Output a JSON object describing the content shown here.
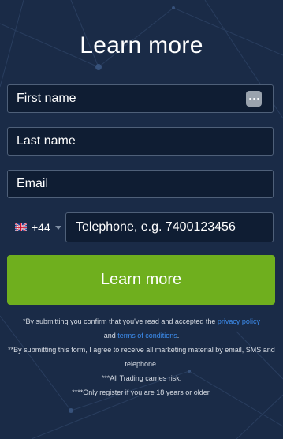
{
  "form": {
    "title": "Learn more",
    "first_name_placeholder": "First name",
    "last_name_placeholder": "Last name",
    "email_placeholder": "Email",
    "phone": {
      "dial_code": "+44",
      "country_flag_icon": "uk-flag-icon",
      "placeholder": "Telephone, e.g. 7400123456"
    },
    "submit_label": "Learn more",
    "autofill_icon": "password-manager-icon"
  },
  "disclaimer": {
    "line1_prefix": "*By submitting you confirm that you've read and accepted the",
    "privacy_link": "privacy policy",
    "line1_join": "and",
    "terms_link": "terms of conditions",
    "line1_suffix": ".",
    "line2": "**By submitting this form, I agree to receive all marketing material by email, SMS and telephone.",
    "line3": "***All Trading carries risk.",
    "line4": "****Only register if you are 18 years or older."
  },
  "colors": {
    "background": "#1a2b47",
    "field_bg": "#0f1d33",
    "field_border": "#4f6079",
    "button": "#6faf1e",
    "link": "#3d8ef0"
  }
}
